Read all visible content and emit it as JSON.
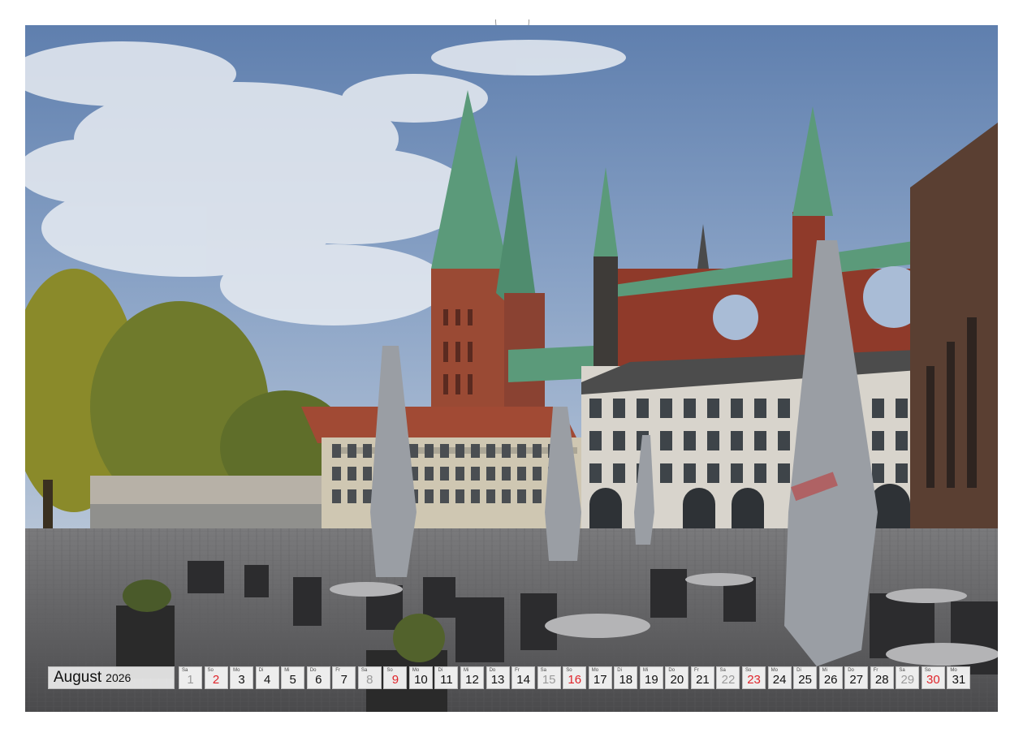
{
  "calendar": {
    "month": "August",
    "year": "2026",
    "days": [
      {
        "wd": "Sa",
        "n": "1",
        "type": "sat"
      },
      {
        "wd": "So",
        "n": "2",
        "type": "sun"
      },
      {
        "wd": "Mo",
        "n": "3",
        "type": "week"
      },
      {
        "wd": "Di",
        "n": "4",
        "type": "week"
      },
      {
        "wd": "Mi",
        "n": "5",
        "type": "week"
      },
      {
        "wd": "Do",
        "n": "6",
        "type": "week"
      },
      {
        "wd": "Fr",
        "n": "7",
        "type": "week"
      },
      {
        "wd": "Sa",
        "n": "8",
        "type": "sat"
      },
      {
        "wd": "So",
        "n": "9",
        "type": "sun"
      },
      {
        "wd": "Mo",
        "n": "10",
        "type": "week"
      },
      {
        "wd": "Di",
        "n": "11",
        "type": "week"
      },
      {
        "wd": "Mi",
        "n": "12",
        "type": "week"
      },
      {
        "wd": "Do",
        "n": "13",
        "type": "week"
      },
      {
        "wd": "Fr",
        "n": "14",
        "type": "week"
      },
      {
        "wd": "Sa",
        "n": "15",
        "type": "sat"
      },
      {
        "wd": "So",
        "n": "16",
        "type": "sun"
      },
      {
        "wd": "Mo",
        "n": "17",
        "type": "week"
      },
      {
        "wd": "Di",
        "n": "18",
        "type": "week"
      },
      {
        "wd": "Mi",
        "n": "19",
        "type": "week"
      },
      {
        "wd": "Do",
        "n": "20",
        "type": "week"
      },
      {
        "wd": "Fr",
        "n": "21",
        "type": "week"
      },
      {
        "wd": "Sa",
        "n": "22",
        "type": "sat"
      },
      {
        "wd": "So",
        "n": "23",
        "type": "sun"
      },
      {
        "wd": "Mo",
        "n": "24",
        "type": "week"
      },
      {
        "wd": "Di",
        "n": "25",
        "type": "week"
      },
      {
        "wd": "Mi",
        "n": "26",
        "type": "week"
      },
      {
        "wd": "Do",
        "n": "27",
        "type": "week"
      },
      {
        "wd": "Fr",
        "n": "28",
        "type": "week"
      },
      {
        "wd": "Sa",
        "n": "29",
        "type": "sat"
      },
      {
        "wd": "So",
        "n": "30",
        "type": "sun"
      },
      {
        "wd": "Mo",
        "n": "31",
        "type": "week"
      }
    ]
  },
  "colors": {
    "sunday": "#e0242a",
    "saturday": "#9a9a9a"
  }
}
